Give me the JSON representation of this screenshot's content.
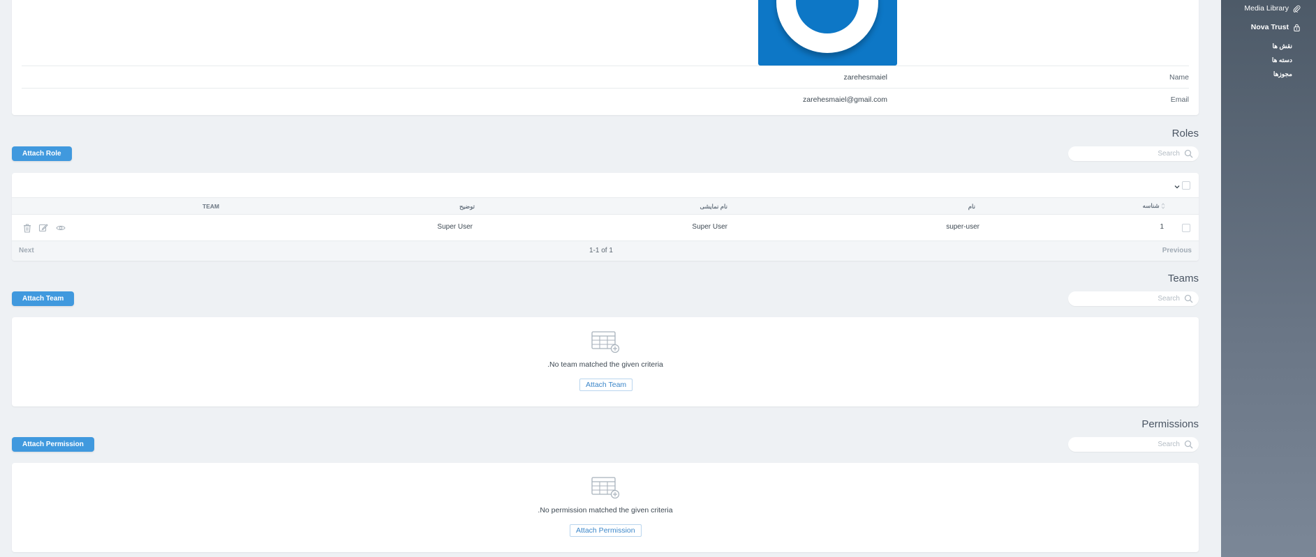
{
  "sidebar": {
    "media_library": "Media Library",
    "nova_trust": "Nova Trust",
    "sub_items": [
      "نقش ها",
      "دسته ها",
      "مجوزها"
    ]
  },
  "detail": {
    "name_label": "Name",
    "name_value": "zarehesmaiel",
    "email_label": "Email",
    "email_value": "zarehesmaiel@gmail.com"
  },
  "roles": {
    "title": "Roles",
    "attach_label": "Attach Role",
    "search_placeholder": "Search",
    "columns": [
      "شناسه",
      "نام",
      "نام نمایشی",
      "توضیح",
      "TEAM"
    ],
    "rows": [
      {
        "id": "1",
        "name": "super-user",
        "display_name": "Super User",
        "description": "Super User",
        "team": ""
      }
    ],
    "pagination": {
      "previous": "Previous",
      "range": "1-1 of 1",
      "next": "Next"
    }
  },
  "teams": {
    "title": "Teams",
    "attach_label": "Attach Team",
    "search_placeholder": "Search",
    "empty_text": "No team matched the given criteria.",
    "empty_button": "Attach Team"
  },
  "permissions": {
    "title": "Permissions",
    "attach_label": "Attach Permission",
    "search_placeholder": "Search",
    "empty_text": "No permission matched the given criteria.",
    "empty_button": "Attach Permission"
  },
  "colors": {
    "primary": "#4099de",
    "sidebar_top": "#4d5a68",
    "avatar_bg": "#0d77c6",
    "page_bg": "#eef1f4"
  }
}
